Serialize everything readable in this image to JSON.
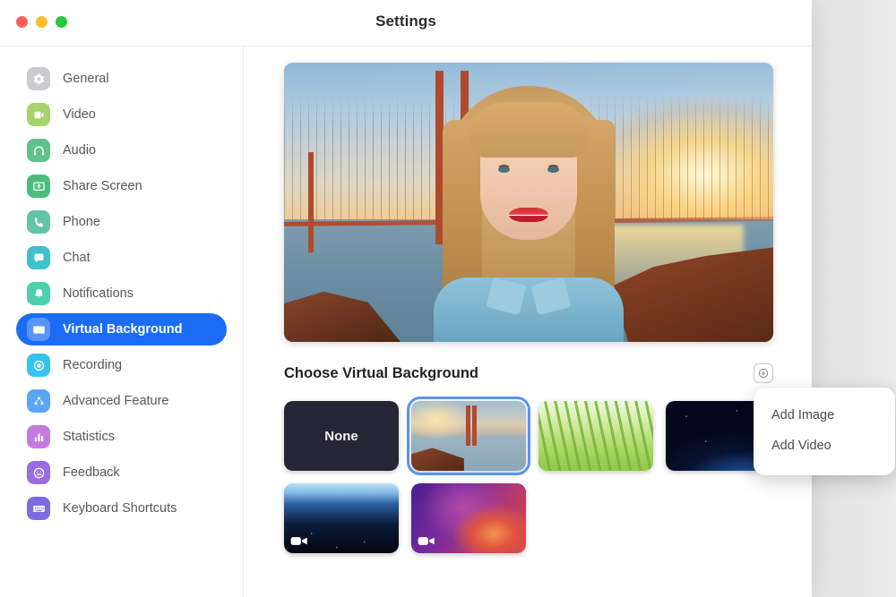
{
  "window": {
    "title": "Settings",
    "traffic_lights": [
      "close",
      "minimize",
      "zoom"
    ]
  },
  "sidebar": {
    "items": [
      {
        "label": "General",
        "icon": "gear-icon",
        "color": "#c9cbcd",
        "active": false
      },
      {
        "label": "Video",
        "icon": "video-camera-icon",
        "color": "#a6d36b",
        "active": false
      },
      {
        "label": "Audio",
        "icon": "headphones-icon",
        "color": "#5fc28a",
        "active": false
      },
      {
        "label": "Share Screen",
        "icon": "share-screen-icon",
        "color": "#4dbd7e",
        "active": false
      },
      {
        "label": "Phone",
        "icon": "phone-icon",
        "color": "#63c5a8",
        "active": false
      },
      {
        "label": "Chat",
        "icon": "chat-bubble-icon",
        "color": "#3fc2ca",
        "active": false
      },
      {
        "label": "Notifications",
        "icon": "bell-icon",
        "color": "#4ecfae",
        "active": false
      },
      {
        "label": "Virtual Background",
        "icon": "virtual-background-icon",
        "color": "#1a6cf5",
        "active": true
      },
      {
        "label": "Recording",
        "icon": "record-circle-icon",
        "color": "#35c3f0",
        "active": false
      },
      {
        "label": "Advanced Feature",
        "icon": "advanced-feature-icon",
        "color": "#5aa6f5",
        "active": false
      },
      {
        "label": "Statistics",
        "icon": "bar-chart-icon",
        "color": "#c67ae0",
        "active": false
      },
      {
        "label": "Feedback",
        "icon": "smiley-face-icon",
        "color": "#9b6ce0",
        "active": false
      },
      {
        "label": "Keyboard Shortcuts",
        "icon": "keyboard-icon",
        "color": "#7f6be0",
        "active": false
      }
    ]
  },
  "main": {
    "preview_alt": "video-preview-woman-golden-gate-bridge",
    "section_title": "Choose Virtual Background",
    "add_button": "add-background-button",
    "thumbnails": [
      {
        "name": "None",
        "kind": "none",
        "selected": false,
        "has_video_badge": false
      },
      {
        "name": "Golden Gate Bridge",
        "kind": "bridge",
        "selected": true,
        "has_video_badge": false
      },
      {
        "name": "Grass",
        "kind": "grass",
        "selected": false,
        "has_video_badge": false
      },
      {
        "name": "Space Sunrise",
        "kind": "space",
        "selected": false,
        "has_video_badge": false
      },
      {
        "name": "Earth From Space",
        "kind": "earth",
        "selected": false,
        "has_video_badge": true
      },
      {
        "name": "Color Gradient",
        "kind": "gradient",
        "selected": false,
        "has_video_badge": true
      }
    ]
  },
  "dropdown": {
    "visible": true,
    "items": [
      {
        "label": "Add Image"
      },
      {
        "label": "Add Video"
      }
    ]
  },
  "background_app": {
    "gear_icon": "gear-icon",
    "avatar": "user-avatar"
  },
  "colors": {
    "accent": "#1a6cf5",
    "selection_ring": "#5a93f0",
    "text": "#575757",
    "title_text": "#2b2b2b",
    "traffic_red": "#ff5f57",
    "traffic_yellow": "#ffbd2e",
    "traffic_green": "#28c840"
  }
}
